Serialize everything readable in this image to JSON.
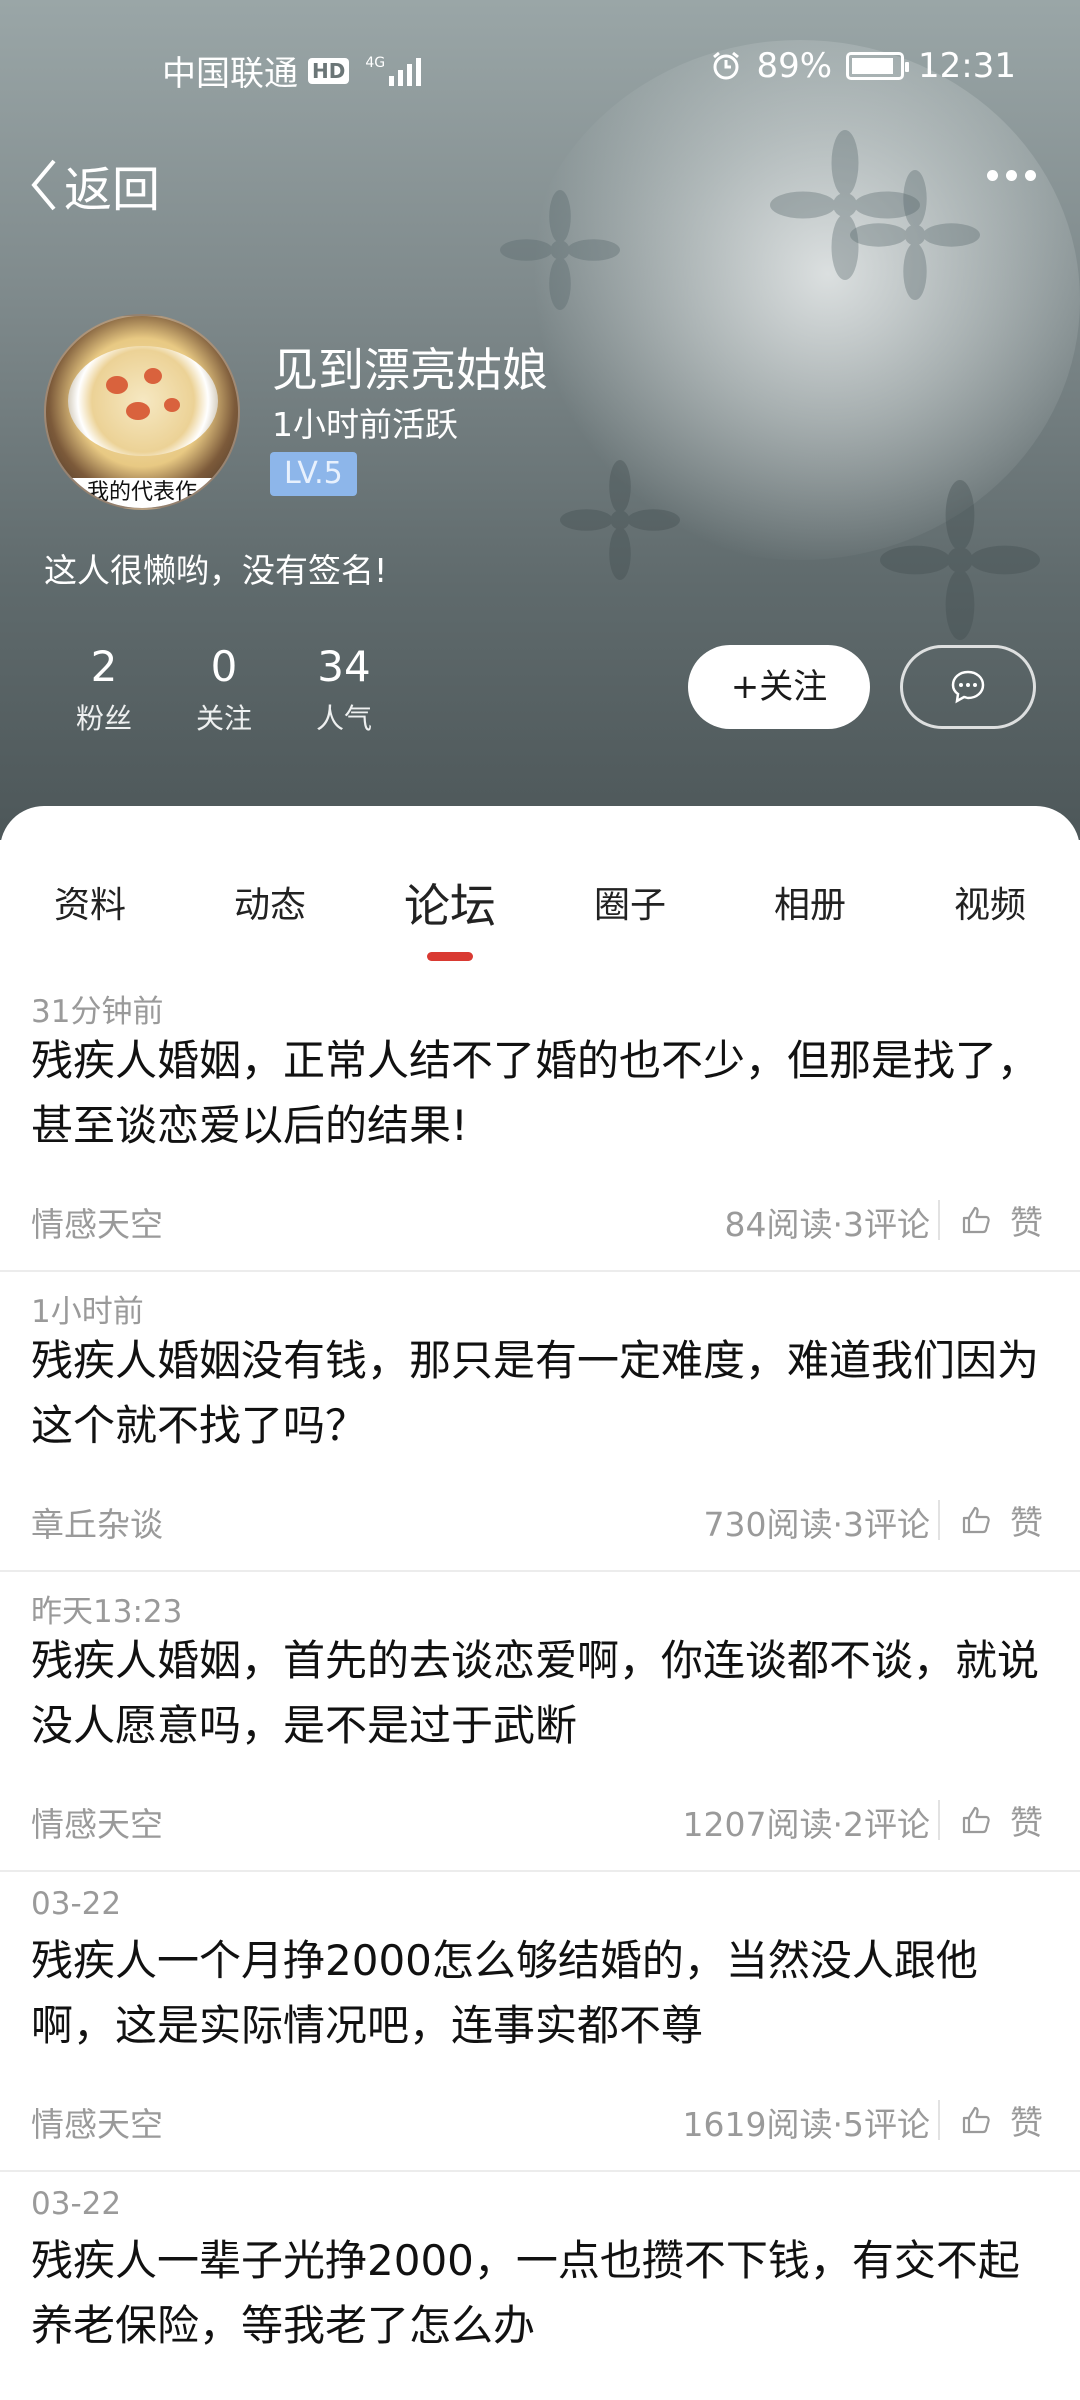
{
  "status_bar": {
    "carrier": "中国联通",
    "hd": "HD",
    "network": "4G",
    "battery_percent": "89%",
    "battery_level": 0.89,
    "time": "12:31"
  },
  "nav": {
    "back_label": "返回"
  },
  "profile": {
    "name": "见到漂亮姑娘",
    "active": "1小时前活跃",
    "level": "LV.5",
    "avatar_caption": "我的代表作",
    "signature": "这人很懒哟，没有签名!",
    "stats": [
      {
        "value": "2",
        "label": "粉丝"
      },
      {
        "value": "0",
        "label": "关注"
      },
      {
        "value": "34",
        "label": "人气"
      }
    ],
    "follow_label": "+关注"
  },
  "tabs": [
    {
      "label": "资料"
    },
    {
      "label": "动态"
    },
    {
      "label": "论坛"
    },
    {
      "label": "圈子"
    },
    {
      "label": "相册"
    },
    {
      "label": "视频"
    }
  ],
  "active_tab": "论坛",
  "posts": [
    {
      "time": "31分钟前",
      "title": "残疾人婚姻，正常人结不了婚的也不少，但那是找了，甚至谈恋爱以后的结果!",
      "category": "情感天空",
      "meta": "84阅读·3评论",
      "like": "赞"
    },
    {
      "time": "1小时前",
      "title": "残疾人婚姻没有钱，那只是有一定难度，难道我们因为这个就不找了吗？",
      "category": "章丘杂谈",
      "meta": "730阅读·3评论",
      "like": "赞"
    },
    {
      "time": "昨天13:23",
      "title": "残疾人婚姻，首先的去谈恋爱啊，你连谈都不谈，就说没人愿意吗，是不是过于武断",
      "category": "情感天空",
      "meta": "1207阅读·2评论",
      "like": "赞"
    },
    {
      "time": "03-22",
      "title": "残疾人一个月挣2000怎么够结婚的，当然没人跟他啊，这是实际情况吧，连事实都不尊",
      "category": "情感天空",
      "meta": "1619阅读·5评论",
      "like": "赞"
    },
    {
      "time": "03-22",
      "title": "残疾人一辈子光挣2000，一点也攒不下钱，有交不起养老保险，等我老了怎么办",
      "category": "",
      "meta": "",
      "like": ""
    }
  ],
  "colors": {
    "accent": "#d93a32",
    "level_badge": "#8db6ea",
    "secondary_text": "#9a9a9a"
  }
}
